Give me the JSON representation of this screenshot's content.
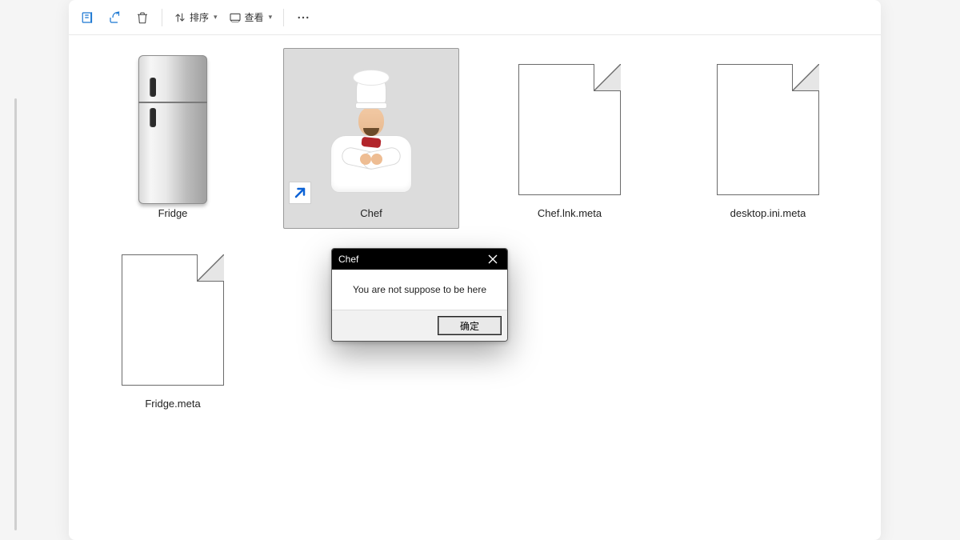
{
  "toolbar": {
    "sort_label": "排序",
    "view_label": "查看"
  },
  "items": [
    {
      "label": "Fridge"
    },
    {
      "label": "Chef"
    },
    {
      "label": "Chef.lnk.meta"
    },
    {
      "label": "desktop.ini.meta"
    },
    {
      "label": "Fridge.meta"
    }
  ],
  "dialog": {
    "title": "Chef",
    "message": "You are not suppose to be here",
    "ok_label": "确定"
  }
}
